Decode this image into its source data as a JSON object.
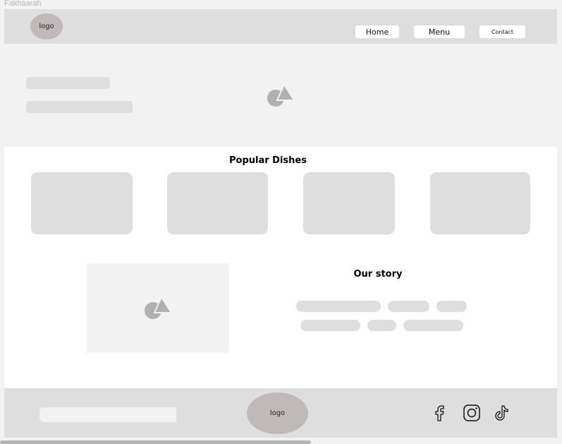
{
  "frame": {
    "title": "Fakhaarah"
  },
  "header": {
    "logo_label": "logo",
    "nav": [
      {
        "label": "Home"
      },
      {
        "label": "Menu"
      },
      {
        "label": "Contact"
      }
    ]
  },
  "hero": {
    "image_icon": "image-placeholder-icon"
  },
  "popular": {
    "title": "Popular Dishes",
    "card_count": 4
  },
  "story": {
    "title": "Our story",
    "image_icon": "image-placeholder-icon"
  },
  "footer": {
    "logo_label": "logo",
    "social": [
      "facebook-icon",
      "instagram-icon",
      "tiktok-icon"
    ]
  },
  "colors": {
    "panel": "#dedede",
    "light_panel": "#f2f2f2",
    "logo_oval": "#c1b8b8",
    "icon_gray": "#b0b0b0"
  }
}
